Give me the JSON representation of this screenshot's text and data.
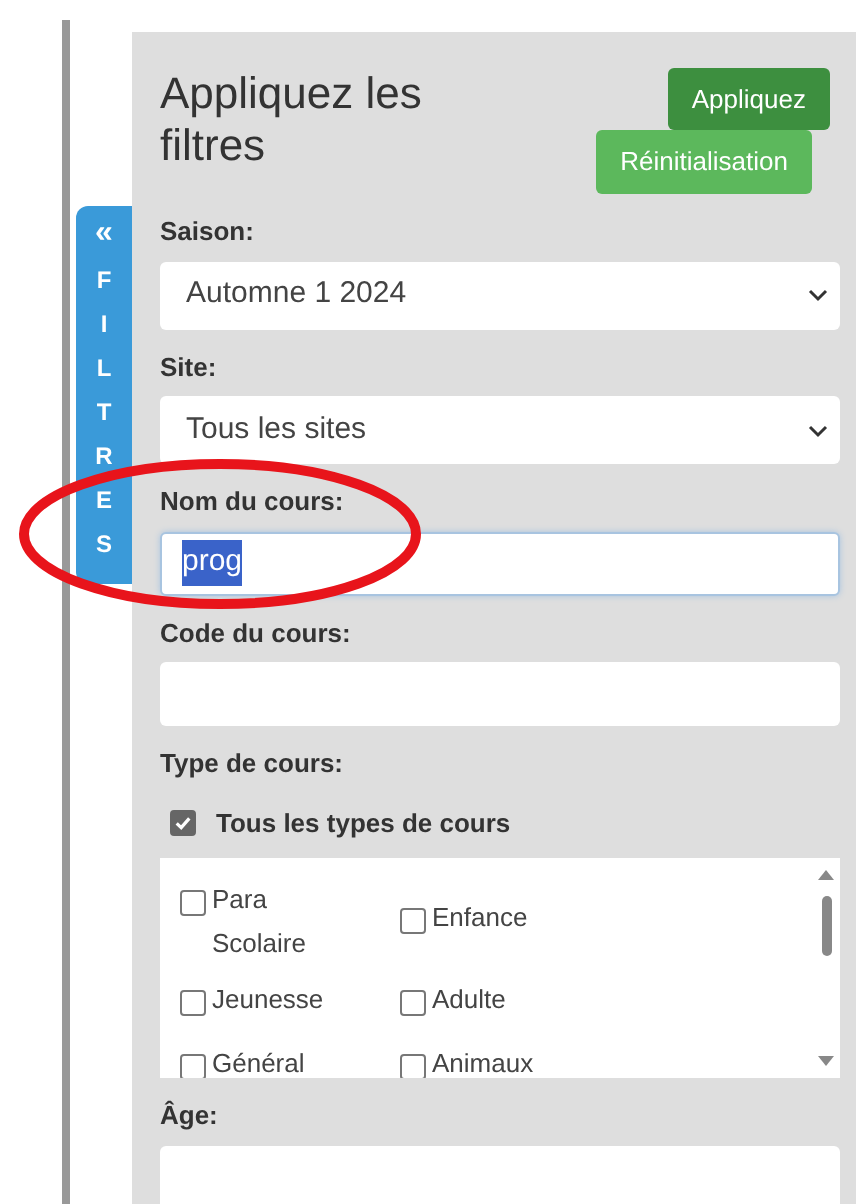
{
  "side_tab": {
    "arrow": "«",
    "label": "FILTRES"
  },
  "panel": {
    "title": "Appliquez les filtres",
    "buttons": [
      {
        "label": "Appliquez",
        "kind": "primary"
      },
      {
        "label": "Réinitialisation",
        "kind": "secondary"
      }
    ],
    "fields": [
      {
        "kind": "select",
        "label": "Saison:",
        "value": "Automne 1 2024"
      },
      {
        "kind": "select",
        "label": "Site:",
        "value": "Tous les sites"
      },
      {
        "kind": "text",
        "label": "Nom du cours:",
        "value": "prog",
        "selected": true
      },
      {
        "kind": "text",
        "label": "Code du cours:",
        "selected": false
      },
      {
        "kind": "checklist",
        "label": "Type de cours:",
        "all": {
          "label": "Tous les types de cours",
          "checked": true
        },
        "options": [
          {
            "label": "Para Scolaire",
            "checked": false
          },
          {
            "label": "Enfance",
            "checked": false
          },
          {
            "label": "Jeunesse",
            "checked": false
          },
          {
            "label": "Adulte",
            "checked": false
          },
          {
            "label": "Général",
            "checked": false
          },
          {
            "label": "Animaux",
            "checked": false
          }
        ]
      },
      {
        "kind": "text",
        "label": "Âge:",
        "selected": false
      }
    ]
  }
}
